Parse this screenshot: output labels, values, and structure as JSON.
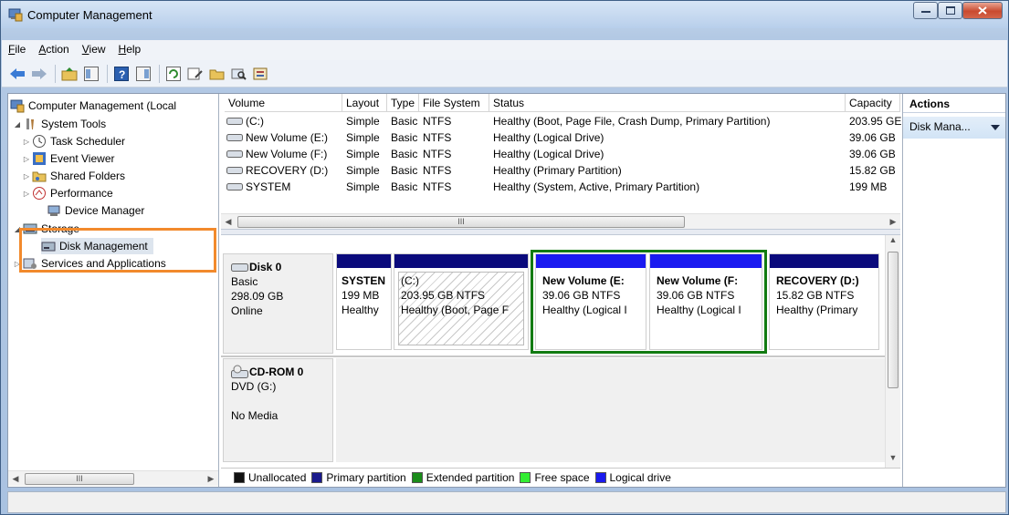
{
  "window": {
    "title": "Computer Management"
  },
  "menu": [
    "File",
    "Action",
    "View",
    "Help"
  ],
  "toolbar": {
    "buttons": [
      "back-icon",
      "forward-icon",
      "up-folder-icon",
      "show-hide-tree-icon",
      "help-icon",
      "properties-pane-icon",
      "refresh-icon",
      "properties-icon",
      "open-icon",
      "search-icon",
      "settings-icon"
    ]
  },
  "tree": {
    "root": "Computer Management (Local",
    "system_tools": "System Tools",
    "task_scheduler": "Task Scheduler",
    "event_viewer": "Event Viewer",
    "shared_folders": "Shared Folders",
    "performance": "Performance",
    "device_manager": "Device Manager",
    "storage": "Storage",
    "disk_management": "Disk Management",
    "services": "Services and Applications",
    "scroll_grip": "III"
  },
  "volumes": {
    "headers": {
      "volume": "Volume",
      "layout": "Layout",
      "type": "Type",
      "fs": "File System",
      "status": "Status",
      "capacity": "Capacity"
    },
    "rows": [
      {
        "volume": "(C:)",
        "layout": "Simple",
        "type": "Basic",
        "fs": "NTFS",
        "status": "Healthy (Boot, Page File, Crash Dump, Primary Partition)",
        "capacity": "203.95 GE"
      },
      {
        "volume": "New Volume (E:)",
        "layout": "Simple",
        "type": "Basic",
        "fs": "NTFS",
        "status": "Healthy (Logical Drive)",
        "capacity": "39.06 GB"
      },
      {
        "volume": "New Volume (F:)",
        "layout": "Simple",
        "type": "Basic",
        "fs": "NTFS",
        "status": "Healthy (Logical Drive)",
        "capacity": "39.06 GB"
      },
      {
        "volume": "RECOVERY (D:)",
        "layout": "Simple",
        "type": "Basic",
        "fs": "NTFS",
        "status": "Healthy (Primary Partition)",
        "capacity": "15.82 GB"
      },
      {
        "volume": "SYSTEM",
        "layout": "Simple",
        "type": "Basic",
        "fs": "NTFS",
        "status": "Healthy (System, Active, Primary Partition)",
        "capacity": "199 MB"
      }
    ],
    "scroll_grip": "III"
  },
  "disk0": {
    "name": "Disk 0",
    "type": "Basic",
    "size": "298.09 GB",
    "state": "Online",
    "partitions": [
      {
        "name": "SYSTEN",
        "size": "199 MB",
        "status": "Healthy",
        "kind": "primary"
      },
      {
        "name": "(C:)",
        "size": "203.95 GB NTFS",
        "status": "Healthy (Boot, Page F",
        "kind": "primary"
      },
      {
        "name": "New Volume  (E:",
        "size": "39.06 GB NTFS",
        "status": "Healthy (Logical I",
        "kind": "logical"
      },
      {
        "name": "New Volume  (F:",
        "size": "39.06 GB NTFS",
        "status": "Healthy (Logical I",
        "kind": "logical"
      },
      {
        "name": "RECOVERY  (D:)",
        "size": "15.82 GB NTFS",
        "status": "Healthy (Primary",
        "kind": "primary"
      }
    ]
  },
  "cdrom0": {
    "name": "CD-ROM 0",
    "drive": "DVD (G:)",
    "media": "No Media"
  },
  "legend": [
    {
      "label": "Unallocated",
      "color": "#111111"
    },
    {
      "label": "Primary partition",
      "color": "#1a1a8c"
    },
    {
      "label": "Extended partition",
      "color": "#1a8c1a"
    },
    {
      "label": "Free space",
      "color": "#33ee33"
    },
    {
      "label": "Logical drive",
      "color": "#1a1aee"
    }
  ],
  "actions": {
    "header": "Actions",
    "item": "Disk Mana..."
  },
  "colors": {
    "primary": "#0a0a7c",
    "logical": "#1a1af0",
    "highlight_tree": "#f28a2c",
    "highlight_extended": "#127b12"
  }
}
